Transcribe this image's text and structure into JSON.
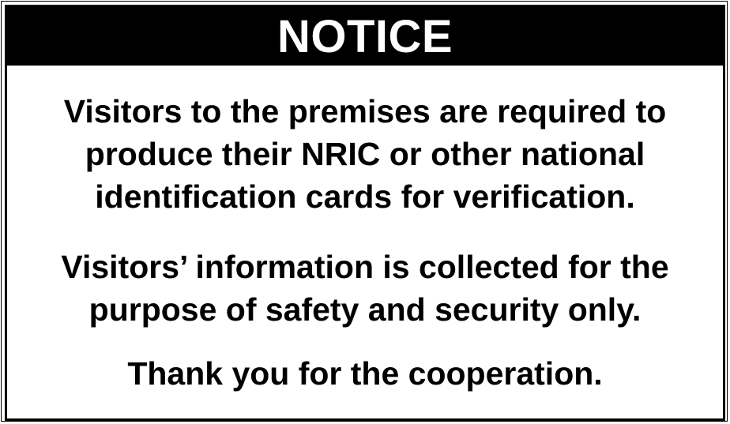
{
  "sign": {
    "title": "NOTICE",
    "paragraph1": [
      "Visitors to the premises are required to",
      "produce their NRIC or other national",
      "identification cards for verification."
    ],
    "paragraph2": [
      "Visitors’ information is collected for the",
      "purpose of safety and security only."
    ],
    "paragraph3": [
      "Thank you for the cooperation."
    ],
    "colors": {
      "band": "#000000",
      "title_text": "#ffffff",
      "body_text": "#000000",
      "background": "#ffffff"
    }
  }
}
